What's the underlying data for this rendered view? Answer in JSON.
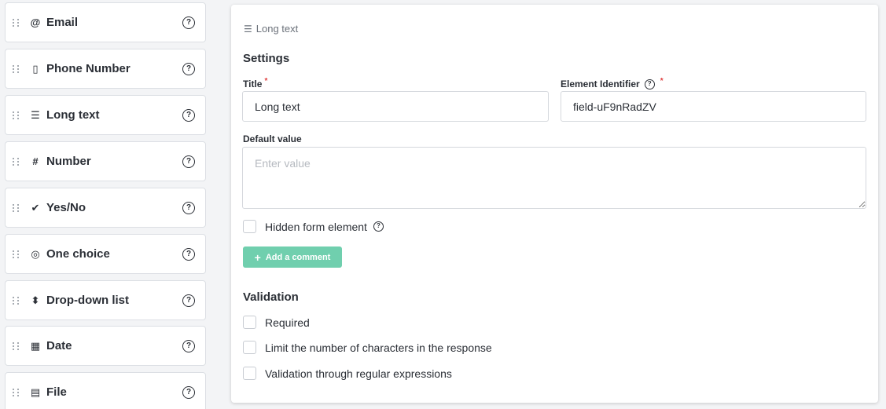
{
  "palette": {
    "items": [
      {
        "icon": "@",
        "icon_name": "at-sign-icon",
        "label": "Email"
      },
      {
        "icon": "▯",
        "icon_name": "phone-icon",
        "label": "Phone Number"
      },
      {
        "icon": "☰",
        "icon_name": "long-text-icon",
        "label": "Long text"
      },
      {
        "icon": "#",
        "icon_name": "hash-icon",
        "label": "Number"
      },
      {
        "icon": "✔",
        "icon_name": "check-icon",
        "label": "Yes/No"
      },
      {
        "icon": "◎",
        "icon_name": "radio-icon",
        "label": "One choice"
      },
      {
        "icon": "⬍",
        "icon_name": "select-arrows-icon",
        "label": "Drop-down list"
      },
      {
        "icon": "▦",
        "icon_name": "calendar-icon",
        "label": "Date"
      },
      {
        "icon": "▤",
        "icon_name": "file-icon",
        "label": "File"
      }
    ],
    "help_glyph": "?"
  },
  "panel": {
    "header": {
      "icon": "☰",
      "icon_name": "long-text-icon",
      "label": "Long text"
    },
    "settings": {
      "title": "Settings",
      "title_field": {
        "label": "Title",
        "required": "*",
        "value": "Long text"
      },
      "identifier_field": {
        "label": "Element Identifier",
        "help": "?",
        "required": "*",
        "value": "field-uF9nRadZV"
      },
      "default_value": {
        "label": "Default value",
        "placeholder": "Enter value"
      },
      "hidden": {
        "label": "Hidden form element",
        "help": "?"
      },
      "add_comment": {
        "icon": "+",
        "label": "Add a comment"
      }
    },
    "validation": {
      "title": "Validation",
      "options": [
        {
          "label": "Required"
        },
        {
          "label": "Limit the number of characters in the response"
        },
        {
          "label": "Validation through regular expressions"
        }
      ]
    }
  },
  "colors": {
    "accent_button": "#70cfae",
    "required_star": "#e03e3e",
    "page_background": "#f3f4f6"
  }
}
